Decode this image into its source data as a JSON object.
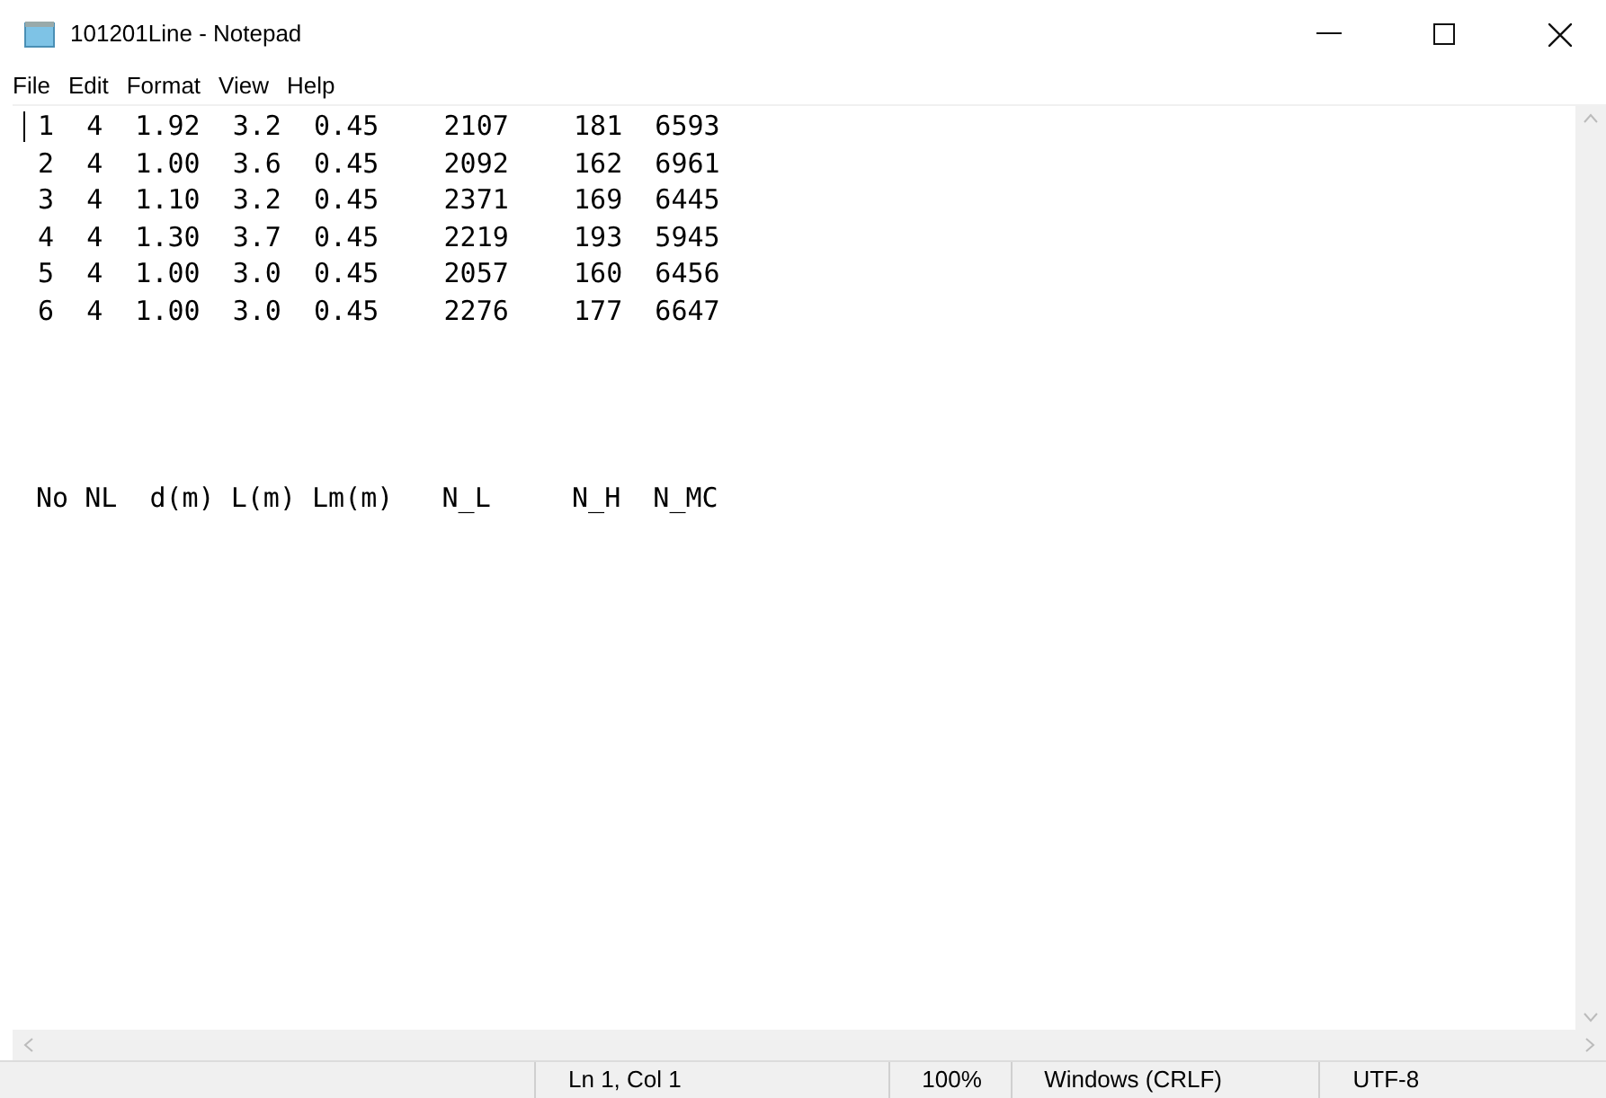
{
  "window": {
    "title": "101201Line - Notepad"
  },
  "menu": [
    "File",
    "Edit",
    "Format",
    "View",
    "Help"
  ],
  "editor": {
    "lines": [
      "1  4  1.92  3.2  0.45    2107    181  6593",
      "2  4  1.00  3.6  0.45    2092    162  6961",
      "3  4  1.10  3.2  0.45    2371    169  6445",
      "4  4  1.30  3.7  0.45    2219    193  5945",
      "5  4  1.00  3.0  0.45    2057    160  6456",
      "6  4  1.00  3.0  0.45    2276    177  6647"
    ],
    "header_line": "No NL  d(m) L(m) Lm(m)   N_L     N_H  N_MC"
  },
  "status_bar": [
    "Ln 1, Col 1",
    "100%",
    "Windows (CRLF)",
    "UTF-8"
  ]
}
